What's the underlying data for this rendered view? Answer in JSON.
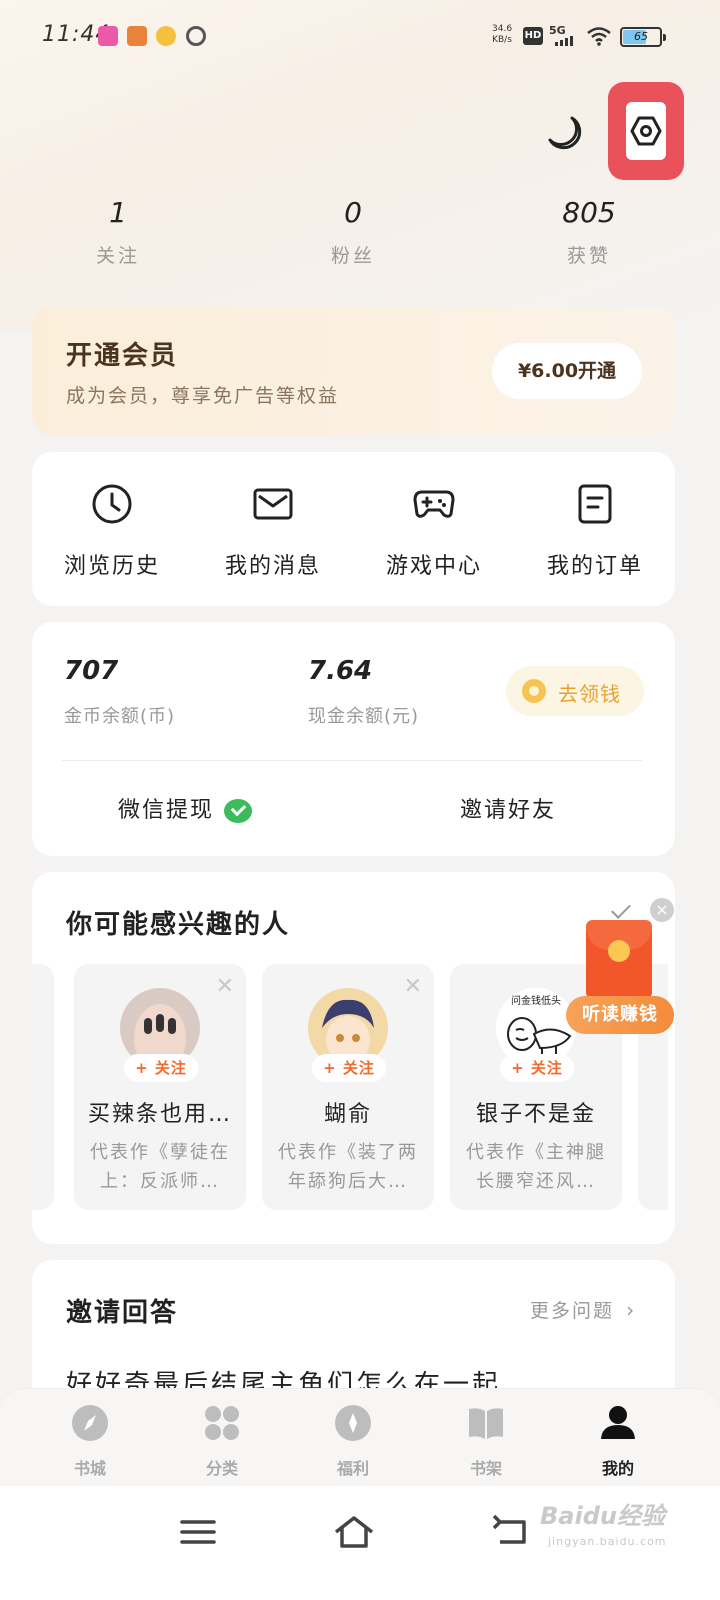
{
  "status_bar": {
    "time": "11:44",
    "net_speed_value": "34.6",
    "net_speed_unit": "KB/s",
    "hd_label": "HD",
    "network_label": "5G",
    "battery": "65",
    "battery_level": 0.65
  },
  "stats": [
    {
      "value": "1",
      "label": "关注"
    },
    {
      "value": "0",
      "label": "粉丝"
    },
    {
      "value": "805",
      "label": "获赞"
    }
  ],
  "vip": {
    "title": "开通会员",
    "desc": "成为会员，尊享免广告等权益",
    "button": "¥6.00开通"
  },
  "quick_actions": [
    {
      "label": "浏览历史",
      "icon": "clock-icon"
    },
    {
      "label": "我的消息",
      "icon": "mail-icon"
    },
    {
      "label": "游戏中心",
      "icon": "gamepad-icon"
    },
    {
      "label": "我的订单",
      "icon": "order-icon"
    }
  ],
  "wallet": {
    "coins": "707",
    "coins_label": "金币余额(币)",
    "cash": "7.64",
    "cash_label": "现金余额(元)",
    "claim_button": "去领钱",
    "withdraw": "微信提现",
    "invite": "邀请好友"
  },
  "interest": {
    "title": "你可能感兴趣的人",
    "follow_label": "+ 关注",
    "people": [
      {
        "name": "买辣条也用…",
        "work": "代表作《孽徒在上：反派师…"
      },
      {
        "name": "蝴俞",
        "work": "代表作《装了两年舔狗后大…"
      },
      {
        "name": "银子不是金",
        "work": "代表作《主神腿长腰窄还风…"
      }
    ],
    "meme_text": "问金钱低头"
  },
  "packet": {
    "label": "听读赚钱",
    "close": "×"
  },
  "answers": {
    "title": "邀请回答",
    "more": "更多问题",
    "question": "好好奇最后结尾主角们怎么在一起"
  },
  "bottom_nav": [
    {
      "label": "书城",
      "icon": "compass-icon",
      "active": false
    },
    {
      "label": "分类",
      "icon": "grid-icon",
      "active": false
    },
    {
      "label": "福利",
      "icon": "gift-icon",
      "active": false
    },
    {
      "label": "书架",
      "icon": "book-icon",
      "active": false
    },
    {
      "label": "我的",
      "icon": "user-icon",
      "active": true
    }
  ],
  "watermark": {
    "brand": "Baidu经验",
    "domain": "jingyan.baidu.com"
  },
  "colors": {
    "accent": "#f06a2c",
    "settings_highlight": "#e9525b",
    "coin": "#e6a32c",
    "wechat": "#3dbb5a"
  }
}
